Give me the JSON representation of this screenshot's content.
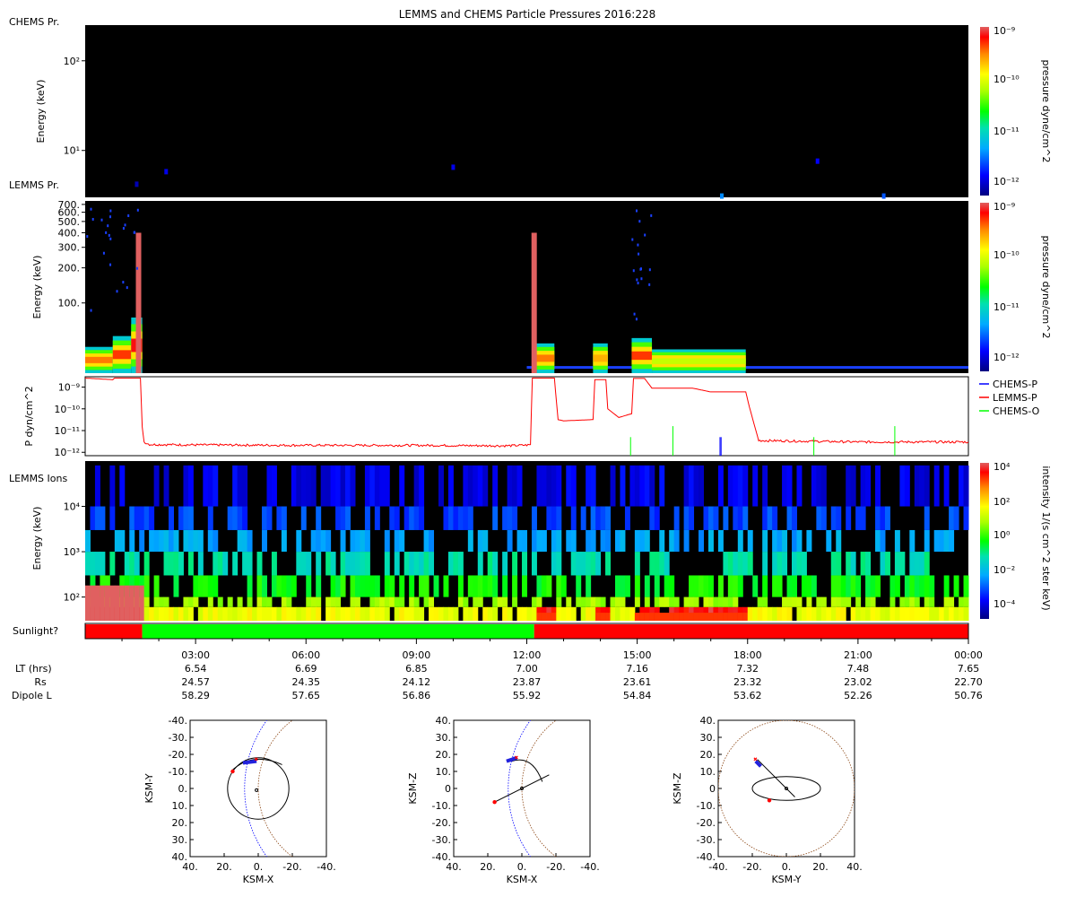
{
  "chart_data": [
    {
      "type": "heatmap",
      "title": "LEMMS and CHEMS Particle Pressures  2016:228",
      "panel_label": "CHEMS Pr.",
      "ylabel": "Energy (keV)",
      "yscale": "log",
      "ylim": [
        3,
        250
      ],
      "yticks": [
        {
          "v": 10,
          "label": "10¹"
        },
        {
          "v": 100,
          "label": "10²"
        }
      ],
      "colorbar": {
        "label": "pressure dyne/cm^2",
        "scale": "log",
        "ticks": [
          "10⁻¹²",
          "10⁻¹¹",
          "10⁻¹⁰",
          "10⁻⁹"
        ]
      },
      "colors": {
        "background": "#000000"
      },
      "blips": [
        {
          "t": 1.4,
          "e": 4.2,
          "level": 0.05
        },
        {
          "t": 2.2,
          "e": 5.8,
          "level": 0.1
        },
        {
          "t": 10.0,
          "e": 6.5,
          "level": 0.1
        },
        {
          "t": 17.3,
          "e": 3.1,
          "level": 0.25
        },
        {
          "t": 19.9,
          "e": 7.6,
          "level": 0.12
        },
        {
          "t": 21.7,
          "e": 3.1,
          "level": 0.2
        }
      ]
    },
    {
      "type": "heatmap",
      "panel_label": "LEMMS Pr.",
      "ylabel": "Energy (keV)",
      "yscale": "log",
      "ylim": [
        25,
        750
      ],
      "yticks": [
        {
          "v": 100,
          "label": "100."
        },
        {
          "v": 200,
          "label": "200."
        },
        {
          "v": 300,
          "label": "300."
        },
        {
          "v": 400,
          "label": "400."
        },
        {
          "v": 500,
          "label": "500."
        },
        {
          "v": 600,
          "label": "600."
        },
        {
          "v": 700,
          "label": "700."
        }
      ],
      "colorbar": {
        "label": "pressure dyne/cm^2",
        "scale": "log",
        "ticks": [
          "10⁻¹²",
          "10⁻¹¹",
          "10⁻¹⁰",
          "10⁻⁹"
        ]
      },
      "bursts": [
        {
          "t0": 0.0,
          "t1": 0.75,
          "top": 42,
          "level": 0.85
        },
        {
          "t0": 0.75,
          "t1": 1.25,
          "top": 52,
          "level": 0.9
        },
        {
          "t0": 1.25,
          "t1": 1.55,
          "top": 75,
          "level": 0.95
        },
        {
          "t0": 12.15,
          "t1": 12.75,
          "top": 45,
          "level": 0.85
        },
        {
          "t0": 13.8,
          "t1": 14.2,
          "top": 45,
          "level": 0.8
        },
        {
          "t0": 14.85,
          "t1": 15.4,
          "top": 50,
          "level": 0.9
        },
        {
          "t0": 15.4,
          "t1": 17.95,
          "top": 40,
          "level": 0.65
        }
      ],
      "spikes": [
        {
          "t": 1.45,
          "top": 400
        },
        {
          "t": 12.2,
          "top": 400
        }
      ],
      "baseline": {
        "t0": 12.0,
        "t1": 24.0,
        "e": 28
      }
    },
    {
      "type": "line",
      "ylabel": "P dyn/cm^2",
      "yscale": "log",
      "ylim": [
        7e-13,
        3e-09
      ],
      "yticks": [
        {
          "v": 1e-09,
          "label": "10⁻⁹"
        },
        {
          "v": 1e-10,
          "label": "10⁻¹⁰"
        },
        {
          "v": 1e-11,
          "label": "10⁻¹¹"
        },
        {
          "v": 1e-12,
          "label": "10⁻¹²"
        }
      ],
      "series": [
        {
          "name": "CHEMS-P",
          "color": "#0000ff",
          "x": [
            17.25,
            17.28
          ],
          "y": [
            5e-12,
            5e-12
          ]
        },
        {
          "name": "LEMMS-P",
          "color": "#ff0000",
          "x": [
            0.0,
            0.75,
            0.8,
            1.5,
            1.55,
            1.6,
            1.75,
            3.0,
            6.0,
            9.0,
            11.5,
            12.1,
            12.15,
            12.25,
            12.75,
            12.85,
            13.0,
            13.8,
            13.85,
            14.15,
            14.2,
            14.5,
            14.85,
            14.9,
            15.2,
            15.4,
            16.5,
            17.0,
            17.95,
            18.05,
            18.3,
            21.0,
            24.0
          ],
          "y": [
            2.6e-09,
            2.2e-09,
            2.6e-09,
            2.6e-09,
            1.5e-11,
            3e-12,
            2.3e-12,
            2.2e-12,
            2.1e-12,
            2.1e-12,
            2e-12,
            2.2e-12,
            2.6e-09,
            2.6e-09,
            2.6e-09,
            3.2e-11,
            2.8e-11,
            3.2e-11,
            2.2e-09,
            2.2e-09,
            1e-10,
            4e-11,
            6e-11,
            2.5e-09,
            2.5e-09,
            9e-10,
            9e-10,
            6e-10,
            6e-10,
            1.2e-10,
            3.5e-12,
            3e-12,
            3e-12
          ]
        },
        {
          "name": "CHEMS-O",
          "color": "#00ff00",
          "x": [
            14.82,
            15.97,
            19.8,
            22.0
          ],
          "y": [
            5e-12,
            1.6e-11,
            5e-12,
            1.6e-11
          ]
        }
      ]
    },
    {
      "type": "heatmap",
      "panel_label": "LEMMS Ions",
      "ylabel": "Energy (keV)",
      "yscale": "log",
      "ylim": [
        30,
        100000
      ],
      "yticks": [
        {
          "v": 100,
          "label": "10²"
        },
        {
          "v": 1000,
          "label": "10³"
        },
        {
          "v": 10000,
          "label": "10⁴"
        }
      ],
      "colorbar": {
        "label": "intensity 1/(s cm^2 ster keV)",
        "scale": "log",
        "ticks": [
          "10⁻⁴",
          "10⁻²",
          "10⁰",
          "10²",
          "10⁴"
        ]
      }
    },
    {
      "type": "bar",
      "panel_label": "Sunlight?",
      "segments": [
        {
          "t0": 0.0,
          "t1": 1.55,
          "color": "#ff0000"
        },
        {
          "t0": 1.55,
          "t1": 12.2,
          "color": "#00ff00"
        },
        {
          "t0": 12.2,
          "t1": 24.0,
          "color": "#ff0000"
        }
      ]
    },
    {
      "type": "table",
      "xlim_hours": [
        0,
        24
      ],
      "x_ticks": [
        "03:00",
        "06:00",
        "09:00",
        "12:00",
        "15:00",
        "18:00",
        "21:00",
        "00:00"
      ],
      "rows": [
        {
          "label": "LT (hrs)",
          "values": [
            "6.54",
            "6.69",
            "6.85",
            "7.00",
            "7.16",
            "7.32",
            "7.48",
            "7.65"
          ]
        },
        {
          "label": "Rs",
          "values": [
            "24.57",
            "24.35",
            "24.12",
            "23.87",
            "23.61",
            "23.32",
            "23.02",
            "22.70"
          ]
        },
        {
          "label": "Dipole L",
          "values": [
            "58.29",
            "57.65",
            "56.86",
            "55.92",
            "54.84",
            "53.62",
            "52.26",
            "50.76"
          ]
        }
      ]
    },
    {
      "type": "scatter",
      "orbit_plots": [
        {
          "xlabel": "KSM-X",
          "ylabel": "KSM-Y",
          "x_ticks": [
            "40.",
            "20.",
            "0.",
            "-20.",
            "-40."
          ],
          "y_ticks": [
            "-40.",
            "-30.",
            "-20.",
            "-10.",
            "0.",
            "10.",
            "20.",
            "30.",
            "40."
          ]
        },
        {
          "xlabel": "KSM-X",
          "ylabel": "KSM-Z",
          "x_ticks": [
            "40.",
            "20.",
            "0.",
            "-20.",
            "-40."
          ],
          "y_ticks": [
            "40.",
            "30.",
            "20.",
            "10.",
            "0",
            "-10.",
            "-20.",
            "-30.",
            "-40."
          ]
        },
        {
          "xlabel": "KSM-Y",
          "ylabel": "KSM-Z",
          "x_ticks": [
            "-40.",
            "-20.",
            "0.",
            "20.",
            "40."
          ],
          "y_ticks": [
            "40.",
            "30.",
            "20.",
            "10.",
            "0",
            "-10.",
            "-20.",
            "-30.",
            "-40."
          ]
        }
      ]
    }
  ]
}
